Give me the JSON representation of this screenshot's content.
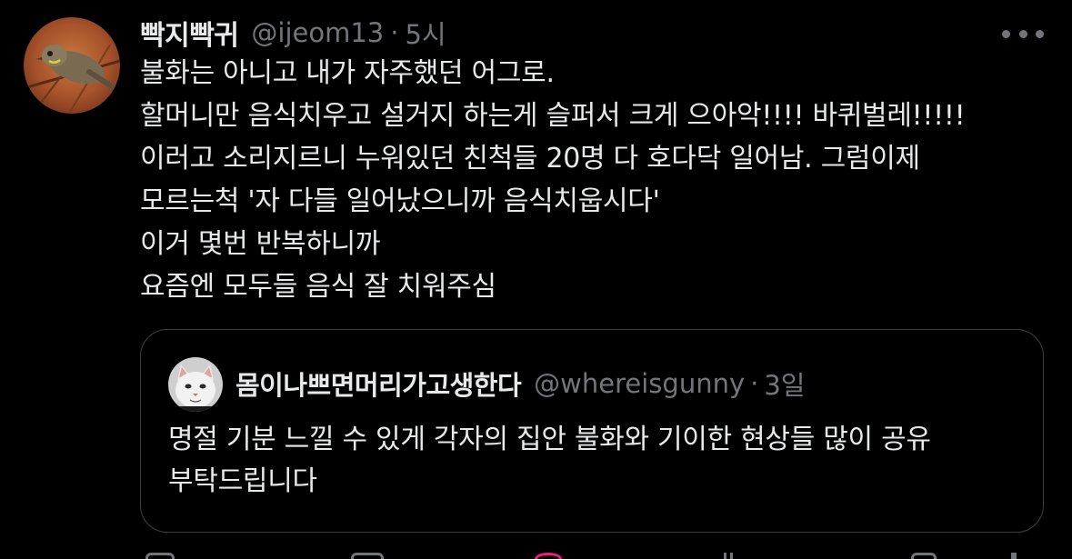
{
  "tweet": {
    "display_name": "빡지빡귀",
    "handle": "@ijeom13",
    "separator": "·",
    "time": "5시",
    "more_icon": "more-horizontal-icon",
    "body_lines": [
      "불화는 아니고 내가 자주했던 어그로.",
      "할머니만 음식치우고 설거지 하는게 슬퍼서 크게 으아악!!!! 바퀴벌레!!!!!",
      "이러고 소리지르니 누워있던 친척들 20명 다 호다닥 일어남. 그럼이제",
      "모르는척 '자 다들 일어났으니까 음식치웁시다'",
      "이거 몇번 반복하니까",
      "요즘엔 모두들 음식 잘 치워주심"
    ]
  },
  "quoted_tweet": {
    "display_name": "몸이나쁘면머리가고생한다",
    "handle": "@whereisgunny",
    "separator": "·",
    "time": "3일",
    "body_lines": [
      "명절 기분 느낄 수 있게 각자의 집안 불화와 기이한 현상들 많이 공유",
      "부탁드립니다"
    ]
  },
  "actions": [
    "reply-icon",
    "retweet-icon",
    "like-icon",
    "views-icon",
    "bookmark-icon",
    "share-icon"
  ],
  "colors": {
    "background": "#000000",
    "primary_text": "#e7e9ea",
    "secondary_text": "#71767b",
    "border": "#3b3f44",
    "like_accent": "#f91880"
  }
}
